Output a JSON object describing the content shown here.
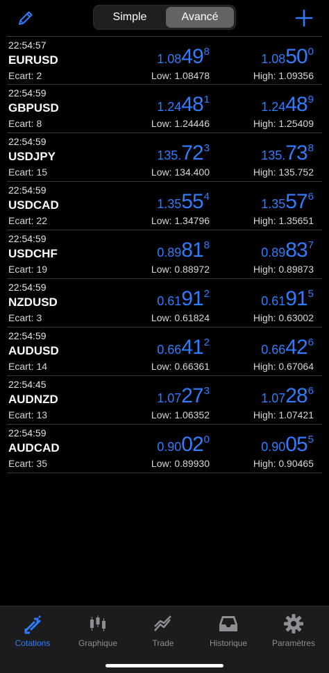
{
  "header": {
    "segment_simple": "Simple",
    "segment_advanced": "Avancé",
    "active_segment": "Avancé",
    "edit_icon": "pencil-icon",
    "add_icon": "plus-icon",
    "accent_color": "#2f7dff"
  },
  "quotes": [
    {
      "time": "22:54:57",
      "symbol": "EURUSD",
      "spread": "Ecart: 2",
      "bid": {
        "small": "1.08",
        "big": "49",
        "sup": "8"
      },
      "ask": {
        "small": "1.08",
        "big": "50",
        "sup": "0"
      },
      "low": "Low: 1.08478",
      "high": "High: 1.09356"
    },
    {
      "time": "22:54:59",
      "symbol": "GBPUSD",
      "spread": "Ecart: 8",
      "bid": {
        "small": "1.24",
        "big": "48",
        "sup": "1"
      },
      "ask": {
        "small": "1.24",
        "big": "48",
        "sup": "9"
      },
      "low": "Low: 1.24446",
      "high": "High: 1.25409"
    },
    {
      "time": "22:54:59",
      "symbol": "USDJPY",
      "spread": "Ecart: 15",
      "bid": {
        "small": "135.",
        "big": "72",
        "sup": "3"
      },
      "ask": {
        "small": "135.",
        "big": "73",
        "sup": "8"
      },
      "low": "Low: 134.400",
      "high": "High: 135.752"
    },
    {
      "time": "22:54:59",
      "symbol": "USDCAD",
      "spread": "Ecart: 22",
      "bid": {
        "small": "1.35",
        "big": "55",
        "sup": "4"
      },
      "ask": {
        "small": "1.35",
        "big": "57",
        "sup": "6"
      },
      "low": "Low: 1.34796",
      "high": "High: 1.35651"
    },
    {
      "time": "22:54:59",
      "symbol": "USDCHF",
      "spread": "Ecart: 19",
      "bid": {
        "small": "0.89",
        "big": "81",
        "sup": "8"
      },
      "ask": {
        "small": "0.89",
        "big": "83",
        "sup": "7"
      },
      "low": "Low: 0.88972",
      "high": "High: 0.89873"
    },
    {
      "time": "22:54:59",
      "symbol": "NZDUSD",
      "spread": "Ecart: 3",
      "bid": {
        "small": "0.61",
        "big": "91",
        "sup": "2"
      },
      "ask": {
        "small": "0.61",
        "big": "91",
        "sup": "5"
      },
      "low": "Low: 0.61824",
      "high": "High: 0.63002"
    },
    {
      "time": "22:54:59",
      "symbol": "AUDUSD",
      "spread": "Ecart: 14",
      "bid": {
        "small": "0.66",
        "big": "41",
        "sup": "2"
      },
      "ask": {
        "small": "0.66",
        "big": "42",
        "sup": "6"
      },
      "low": "Low: 0.66361",
      "high": "High: 0.67064"
    },
    {
      "time": "22:54:45",
      "symbol": "AUDNZD",
      "spread": "Ecart: 13",
      "bid": {
        "small": "1.07",
        "big": "27",
        "sup": "3"
      },
      "ask": {
        "small": "1.07",
        "big": "28",
        "sup": "6"
      },
      "low": "Low: 1.06352",
      "high": "High: 1.07421"
    },
    {
      "time": "22:54:59",
      "symbol": "AUDCAD",
      "spread": "Ecart: 35",
      "bid": {
        "small": "0.90",
        "big": "02",
        "sup": "0"
      },
      "ask": {
        "small": "0.90",
        "big": "05",
        "sup": "5"
      },
      "low": "Low: 0.89930",
      "high": "High: 0.90465"
    }
  ],
  "tabs": [
    {
      "label": "Cotations",
      "icon": "quotes-arrows-icon",
      "active": true
    },
    {
      "label": "Graphique",
      "icon": "candlestick-chart-icon",
      "active": false
    },
    {
      "label": "Trade",
      "icon": "trade-chart-icon",
      "active": false
    },
    {
      "label": "Historique",
      "icon": "history-inbox-icon",
      "active": false
    },
    {
      "label": "Paramètres",
      "icon": "gear-icon",
      "active": false
    }
  ]
}
